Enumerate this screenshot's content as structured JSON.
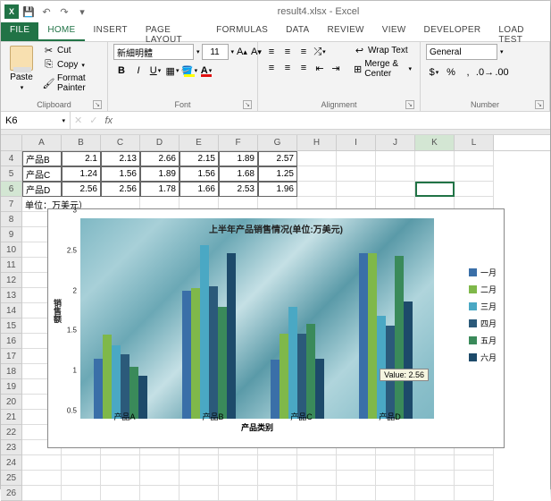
{
  "titlebar": {
    "filename": "result4.xlsx - Excel"
  },
  "tabs": {
    "file": "FILE",
    "home": "HOME",
    "insert": "INSERT",
    "page_layout": "PAGE LAYOUT",
    "formulas": "FORMULAS",
    "data": "DATA",
    "review": "REVIEW",
    "view": "VIEW",
    "developer": "DEVELOPER",
    "load_test": "LOAD TEST"
  },
  "ribbon": {
    "clipboard": {
      "paste": "Paste",
      "cut": "Cut",
      "copy": "Copy",
      "format_painter": "Format Painter",
      "title": "Clipboard"
    },
    "font": {
      "name": "新細明體",
      "size": "11",
      "title": "Font"
    },
    "alignment": {
      "wrap": "Wrap Text",
      "merge": "Merge & Center",
      "title": "Alignment"
    },
    "number": {
      "format": "General",
      "title": "Number"
    }
  },
  "namebox": "K6",
  "grid": {
    "cols": [
      "A",
      "B",
      "C",
      "D",
      "E",
      "F",
      "G",
      "H",
      "I",
      "J",
      "K",
      "L"
    ],
    "rows": [
      {
        "n": "4",
        "cells": [
          "产品B",
          "2.1",
          "2.13",
          "2.66",
          "2.15",
          "1.89",
          "2.57",
          "",
          "",
          "",
          "",
          ""
        ]
      },
      {
        "n": "5",
        "cells": [
          "产品C",
          "1.24",
          "1.56",
          "1.89",
          "1.56",
          "1.68",
          "1.25",
          "",
          "",
          "",
          "",
          ""
        ]
      },
      {
        "n": "6",
        "cells": [
          "产品D",
          "2.56",
          "2.56",
          "1.78",
          "1.66",
          "2.53",
          "1.96",
          "",
          "",
          "",
          "",
          ""
        ]
      },
      {
        "n": "7",
        "cells": [
          "单位：万美元）",
          "",
          "",
          "",
          "",
          "",
          "",
          "",
          "",
          "",
          "",
          ""
        ]
      }
    ],
    "emptyrows": [
      "8",
      "9",
      "10",
      "11",
      "12",
      "13",
      "14",
      "15",
      "16",
      "17",
      "18",
      "19",
      "20",
      "21",
      "22",
      "23",
      "24",
      "25",
      "26"
    ]
  },
  "chart": {
    "title": "上半年产品销售情况(单位:万美元)",
    "ylabel": "销售额",
    "xlabel": "产品类别",
    "tooltip": "Value: 2.56",
    "legend": [
      {
        "label": "一月",
        "color": "#3a6fa8"
      },
      {
        "label": "二月",
        "color": "#7fb84a"
      },
      {
        "label": "三月",
        "color": "#4aa8c4"
      },
      {
        "label": "四月",
        "color": "#2b5a7a"
      },
      {
        "label": "五月",
        "color": "#3a8a5a"
      },
      {
        "label": "六月",
        "color": "#1d4a6a"
      }
    ],
    "xcats": [
      "产品A",
      "产品B",
      "产品C",
      "产品D"
    ],
    "yticks": [
      "0.5",
      "1",
      "1.5",
      "2",
      "2.5",
      "3"
    ]
  },
  "chart_data": {
    "type": "bar",
    "title": "上半年产品销售情况(单位:万美元)",
    "xlabel": "产品类别",
    "ylabel": "销售额",
    "ylim": [
      0.5,
      3
    ],
    "categories": [
      "产品A",
      "产品B",
      "产品C",
      "产品D"
    ],
    "series": [
      {
        "name": "一月",
        "values": [
          1.25,
          2.1,
          1.24,
          2.56
        ]
      },
      {
        "name": "二月",
        "values": [
          1.55,
          2.13,
          1.56,
          2.56
        ]
      },
      {
        "name": "三月",
        "values": [
          1.42,
          2.66,
          1.89,
          1.78
        ]
      },
      {
        "name": "四月",
        "values": [
          1.3,
          2.15,
          1.56,
          1.66
        ]
      },
      {
        "name": "五月",
        "values": [
          1.15,
          1.89,
          1.68,
          2.53
        ]
      },
      {
        "name": "六月",
        "values": [
          1.04,
          2.57,
          1.25,
          1.96
        ]
      }
    ]
  }
}
